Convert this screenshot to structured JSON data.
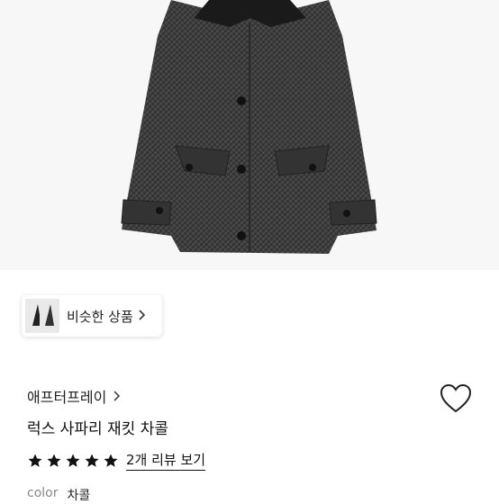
{
  "similar": {
    "label": "비슷한 상품"
  },
  "product": {
    "brand": "애프터프레이",
    "title": "럭스 사파리 재킷 차콜",
    "rating_stars": 5,
    "review_link": "2개 리뷰 보기",
    "color_label": "color",
    "color_value": "차콜"
  },
  "icons": {
    "wishlist": "heart-icon",
    "similar_chevron": "chevron-right-icon",
    "brand_chevron": "chevron-right-icon",
    "star": "star-icon"
  },
  "colors": {
    "jacket": "#3a3a3a",
    "collar": "#1a1a1a",
    "star": "#111111"
  }
}
